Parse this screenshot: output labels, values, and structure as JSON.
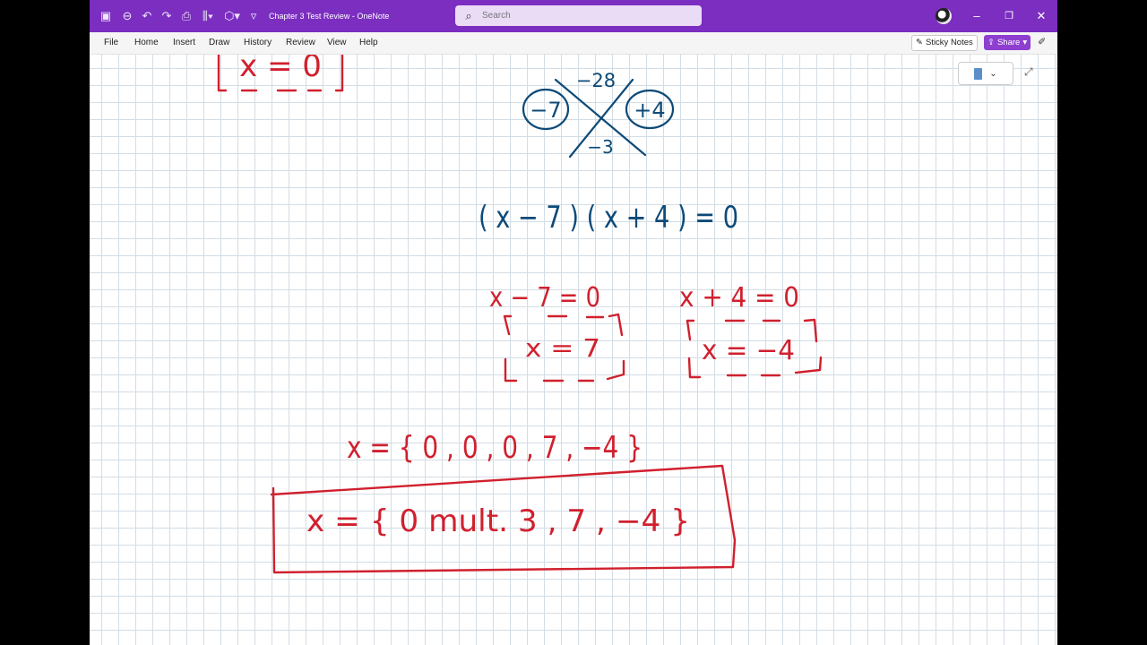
{
  "window": {
    "title": "Chapter 3 Test Review  -  OneNote",
    "search_placeholder": "Search",
    "controls": {
      "minimize": "–",
      "restore": "❐",
      "close": "✕"
    }
  },
  "quick_access": {
    "icons": [
      "onenote-logo-icon",
      "back-icon",
      "undo-icon",
      "redo-icon",
      "print-icon",
      "view-icon",
      "shapes-icon",
      "customize-icon"
    ]
  },
  "menu": {
    "items": [
      "File",
      "Home",
      "Insert",
      "Draw",
      "History",
      "Review",
      "View",
      "Help"
    ],
    "sticky_notes": "Sticky Notes",
    "share": "Share"
  },
  "notes": {
    "partial_top": "x = 0",
    "diamond": {
      "top": "−28",
      "bottom": "−3",
      "left": "−7",
      "right": "+4"
    },
    "factored": "( x − 7 ) ( x + 4 )  =  0",
    "eq1": "x − 7 = 0",
    "eq1_solution": "x = 7",
    "eq2": "x + 4 = 0",
    "eq2_solution": "x = −4",
    "solution_set": "x = { 0 , 0 , 0 ,  7 , −4 }",
    "final_answer": "x = {  0  mult. 3  ,  7 ,  −4  }"
  },
  "colors": {
    "title_bar": "#7b2ec0",
    "ink_red": "#d0202e",
    "ink_blue": "#0d4a78",
    "share": "#8e3fd0"
  }
}
